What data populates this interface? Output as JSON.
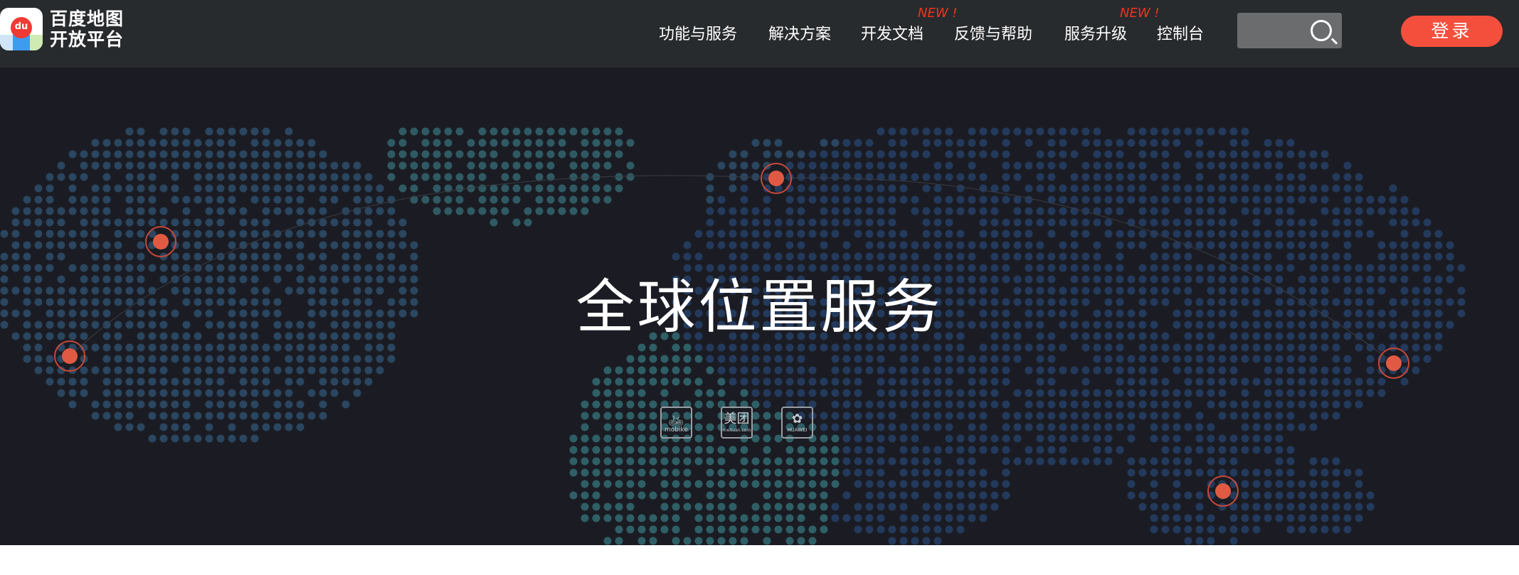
{
  "header": {
    "logo_text_line1": "百度地图",
    "logo_text_line2": "开放平台",
    "logo_pin_text": "du",
    "nav": [
      {
        "label": "功能与服务"
      },
      {
        "label": "解决方案"
      },
      {
        "label": "开发文档",
        "badge": "NEW !"
      },
      {
        "label": "反馈与帮助"
      },
      {
        "label": "服务升级",
        "badge": "NEW !"
      },
      {
        "label": "控制台"
      }
    ],
    "search_placeholder": "",
    "login_label": "登录"
  },
  "banner": {
    "title": "全球位置服务",
    "partners": [
      {
        "name": "mobike",
        "glyph": "🚲"
      },
      {
        "name": "meituan.com",
        "glyph": "美团"
      },
      {
        "name": "HUAWEI",
        "glyph": "✿"
      }
    ]
  },
  "colors": {
    "accent": "#f44f3d",
    "header_bg": "#282b2d",
    "banner_bg": "#1b1c23",
    "new_badge": "#f0321f"
  }
}
